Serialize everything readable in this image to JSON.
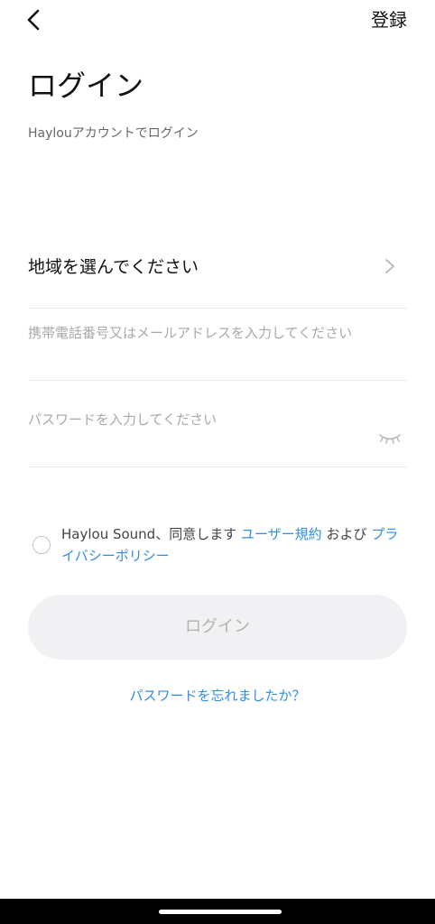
{
  "header": {
    "back_icon": "chevron-left-icon",
    "register_label": "登録"
  },
  "title": "ログイン",
  "subtitle": "Haylouアカウントでログイン",
  "region": {
    "label": "地域を選んでください",
    "icon": "chevron-right-icon"
  },
  "account": {
    "placeholder": "携帯電話番号又はメールアドレスを入力してください",
    "value": ""
  },
  "password": {
    "placeholder": "パスワードを入力してください",
    "value": "",
    "visibility_icon": "eye-closed-icon"
  },
  "agreement": {
    "checked": false,
    "prefix": "Haylou Sound、同意します",
    "terms_link": "ユーザー規約",
    "conjunction": "および",
    "privacy_link": "プライバシーポリシー"
  },
  "login_button": {
    "label": "ログイン",
    "enabled": false
  },
  "forgot_password": "パスワードを忘れましたか？",
  "colors": {
    "link": "#2f8ee8",
    "button_bg_disabled": "#f1f1f3",
    "button_text_disabled": "#b2b2b2",
    "placeholder": "#a9a9a9"
  }
}
